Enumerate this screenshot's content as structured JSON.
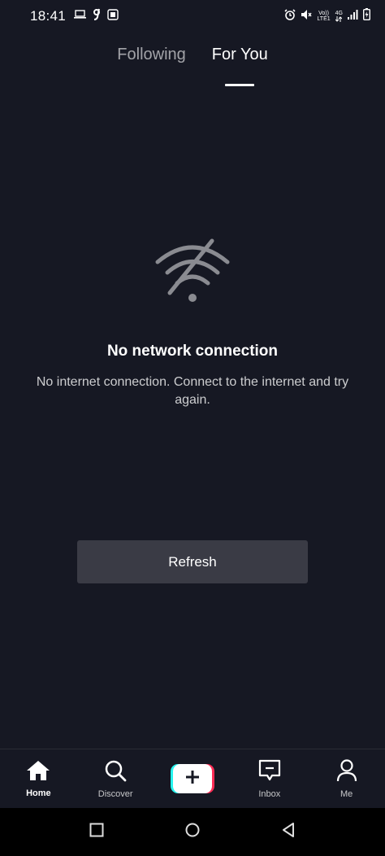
{
  "status_bar": {
    "time": "18:41",
    "left_icons": [
      "laptop-icon",
      "g-app-icon",
      "square-app-icon"
    ],
    "right_icons": [
      "alarm-icon",
      "mute-icon",
      "volte-icon",
      "4g-icon",
      "signal-icon",
      "battery-icon"
    ],
    "volte_line1": "Vo))",
    "volte_line2": "LTE1",
    "network": "4G"
  },
  "feed_tabs": {
    "following": "Following",
    "for_you": "For You",
    "active": "for_you"
  },
  "empty_state": {
    "icon": "wifi-off-icon",
    "title": "No network connection",
    "description": "No internet connection. Connect to the internet and try again."
  },
  "refresh_label": "Refresh",
  "bottom_nav": {
    "home": "Home",
    "discover": "Discover",
    "inbox": "Inbox",
    "me": "Me",
    "active": "home"
  },
  "colors": {
    "background": "#161823",
    "button_bg": "#3a3b45",
    "accent_cyan": "#25f4ee",
    "accent_pink": "#fe2c55"
  }
}
